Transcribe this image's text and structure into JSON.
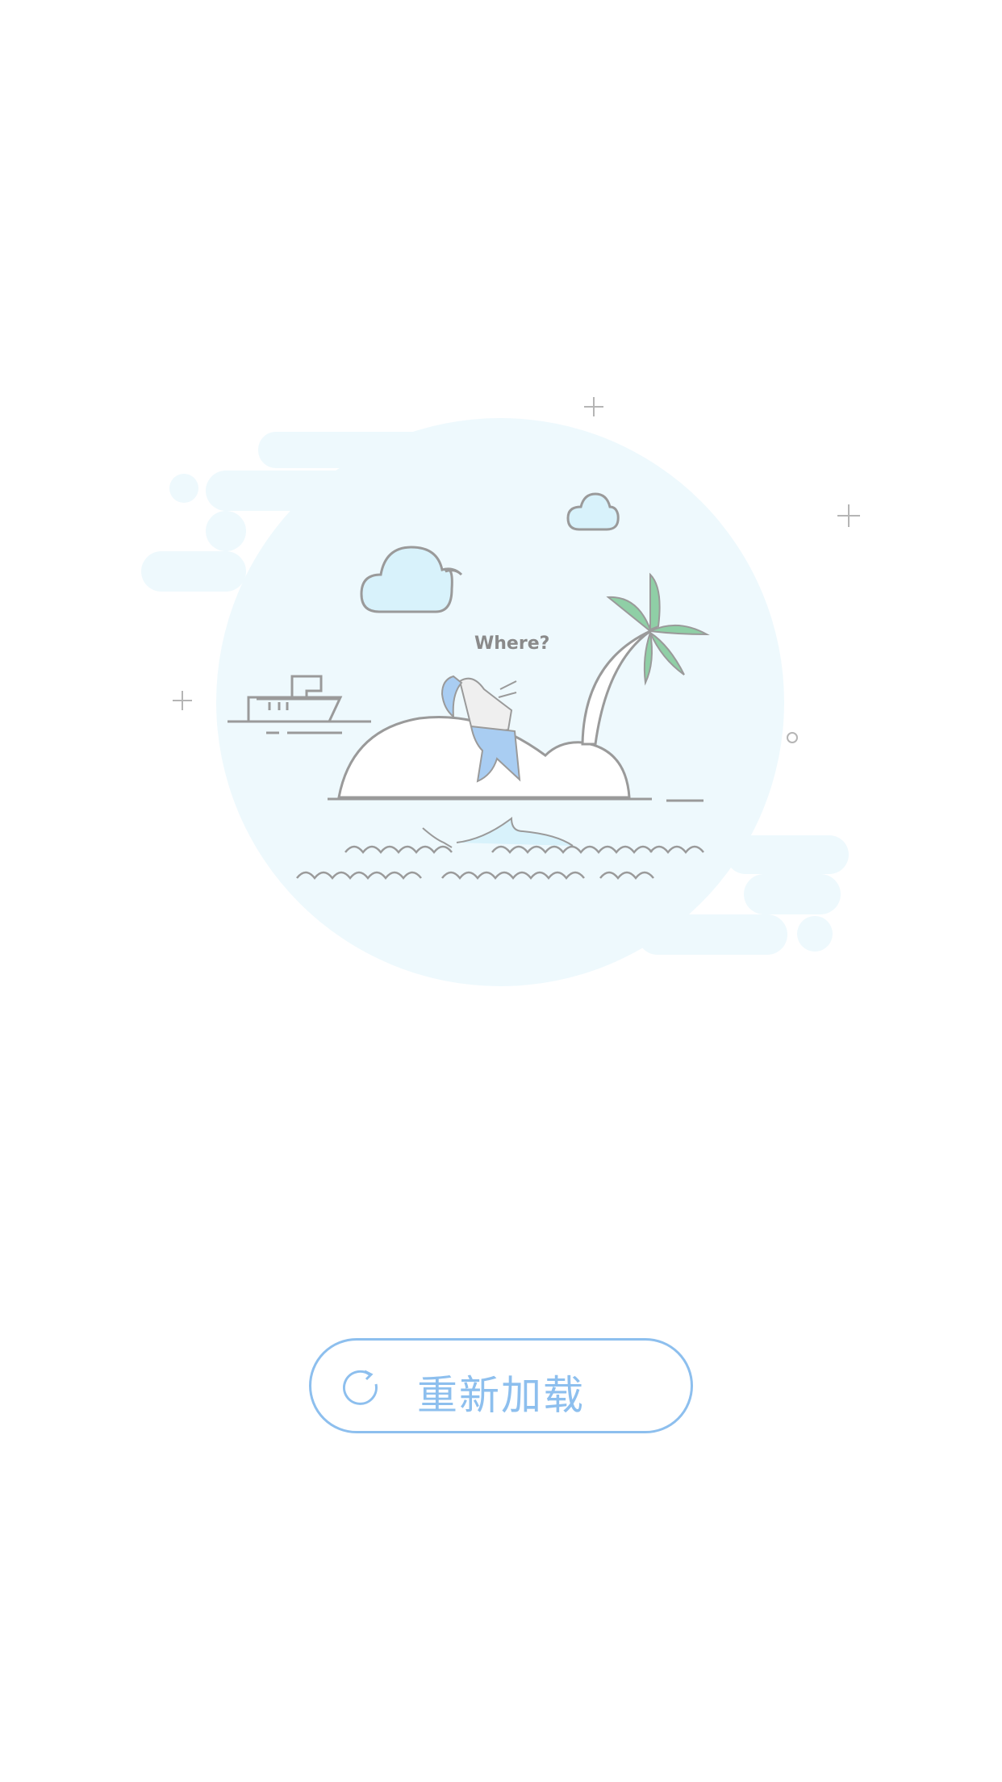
{
  "illustration": {
    "caption": "Where?",
    "colors": {
      "sky_blob": "#eef9fd",
      "cloud_fill": "#d8f2fb",
      "line": "#9a9a9a",
      "palm_leaf": "#8fcfa6",
      "figure_accent": "#a9cdf2"
    }
  },
  "reload_button": {
    "label": "重新加载",
    "icon": "refresh-icon",
    "color": "#8dbfee"
  }
}
